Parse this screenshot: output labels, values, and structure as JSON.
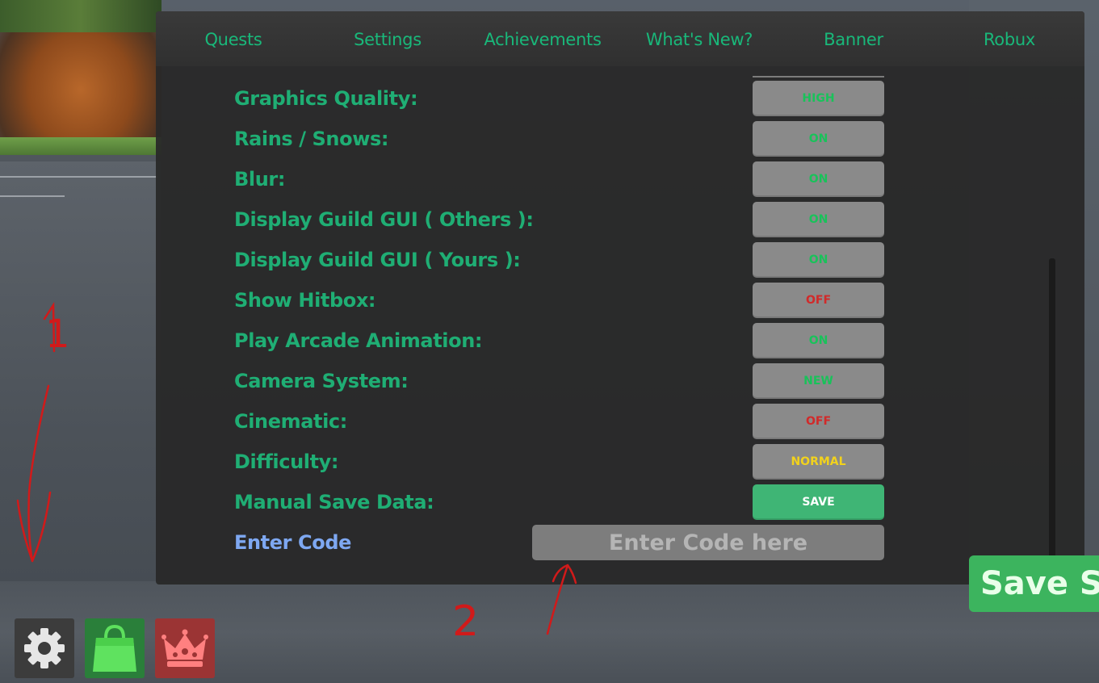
{
  "tabs": [
    {
      "label": "Quests"
    },
    {
      "label": "Settings"
    },
    {
      "label": "Achievements"
    },
    {
      "label": "What's New?"
    },
    {
      "label": "Banner"
    },
    {
      "label": "Robux"
    }
  ],
  "settings": [
    {
      "label": "Graphics Quality:",
      "value": "HIGH",
      "value_color": "#19c25a"
    },
    {
      "label": "Rains / Snows:",
      "value": "ON",
      "value_color": "#19c25a"
    },
    {
      "label": "Blur:",
      "value": "ON",
      "value_color": "#19c25a"
    },
    {
      "label": "Display Guild GUI ( Others ):",
      "value": "ON",
      "value_color": "#19c25a"
    },
    {
      "label": "Display Guild GUI ( Yours ):",
      "value": "ON",
      "value_color": "#19c25a"
    },
    {
      "label": "Show Hitbox:",
      "value": "OFF",
      "value_color": "#d12a2a"
    },
    {
      "label": "Play Arcade Animation:",
      "value": "ON",
      "value_color": "#19c25a"
    },
    {
      "label": "Camera System:",
      "value": "NEW",
      "value_color": "#19c25a"
    },
    {
      "label": "Cinematic:",
      "value": "OFF",
      "value_color": "#d12a2a"
    },
    {
      "label": "Difficulty:",
      "value": "NORMAL",
      "value_color": "#f2d21c"
    },
    {
      "label": "Manual Save Data:",
      "value": "SAVE",
      "value_color": "#ffffff"
    }
  ],
  "code": {
    "label": "Enter Code",
    "placeholder": "Enter Code here"
  },
  "save_settings_button": "Save Settings",
  "annotations": {
    "mark1": "1",
    "mark2": "2",
    "color": "#d11a1a"
  },
  "hud_buttons": [
    {
      "icon": "gear-icon"
    },
    {
      "icon": "shopping-bag-icon"
    },
    {
      "icon": "crown-icon"
    }
  ],
  "colors": {
    "tab_text": "#19b87a",
    "label_text": "#1fae74",
    "code_label": "#7ea8f2",
    "toggle_bg": "#8a8a8a",
    "save_bg": "#3fb575"
  }
}
